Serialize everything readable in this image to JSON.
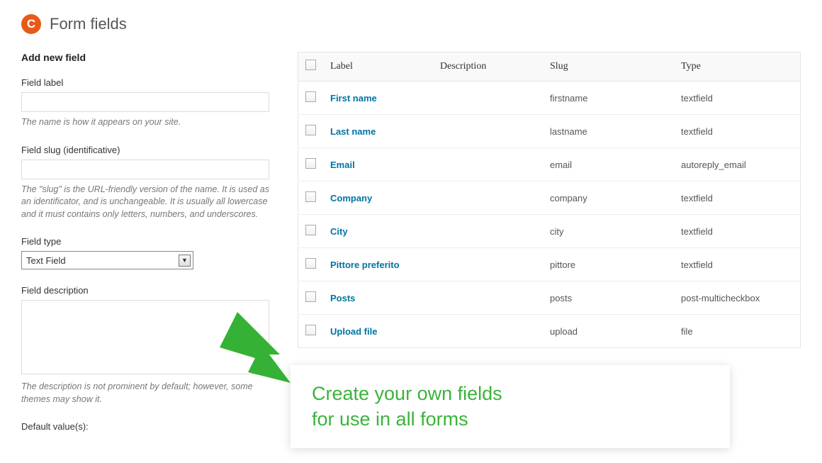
{
  "page_title": "Form fields",
  "logo_letter": "C",
  "left": {
    "heading": "Add new field",
    "field_label": {
      "label": "Field label",
      "value": "",
      "help": "The name is how it appears on your site."
    },
    "field_slug": {
      "label": "Field slug (identificative)",
      "value": "",
      "help": "The \"slug\" is the URL-friendly version of the name. It is used as an identificator, and is unchangeable. It is usually all lowercase and it must contains only letters, numbers, and underscores."
    },
    "field_type": {
      "label": "Field type",
      "selected": "Text Field"
    },
    "field_description": {
      "label": "Field description",
      "value": "",
      "help": "The description is not prominent by default; however, some themes may show it."
    },
    "default_values": {
      "label": "Default value(s):"
    }
  },
  "table": {
    "headers": {
      "label": "Label",
      "description": "Description",
      "slug": "Slug",
      "type": "Type"
    },
    "rows": [
      {
        "label": "First name",
        "description": "",
        "slug": "firstname",
        "type": "textfield"
      },
      {
        "label": "Last name",
        "description": "",
        "slug": "lastname",
        "type": "textfield"
      },
      {
        "label": "Email",
        "description": "",
        "slug": "email",
        "type": "autoreply_email"
      },
      {
        "label": "Company",
        "description": "",
        "slug": "company",
        "type": "textfield"
      },
      {
        "label": "City",
        "description": "",
        "slug": "city",
        "type": "textfield"
      },
      {
        "label": "Pittore preferito",
        "description": "",
        "slug": "pittore",
        "type": "textfield"
      },
      {
        "label": "Posts",
        "description": "",
        "slug": "posts",
        "type": "post-multicheckbox"
      },
      {
        "label": "Upload file",
        "description": "",
        "slug": "upload",
        "type": "file"
      }
    ]
  },
  "callout": {
    "line1": "Create your own fields",
    "line2": "for use in all forms"
  }
}
